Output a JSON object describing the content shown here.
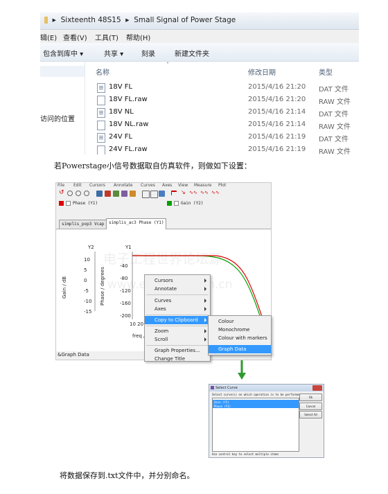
{
  "explorer": {
    "breadcrumb": [
      "Sixteenth 48S15",
      "Small Signal of Power Stage"
    ],
    "menu": [
      "辑(E)",
      "查看(V)",
      "工具(T)",
      "帮助(H)"
    ],
    "toolbar": [
      "包含到库中 ▾",
      "共享 ▾",
      "刻录",
      "新建文件夹"
    ],
    "left_item": "访问的位置",
    "columns": {
      "name": "名称",
      "date": "修改日期",
      "type": "类型"
    },
    "files": [
      {
        "name": "18V FL",
        "date": "2015/4/16 21:20",
        "type": "DAT 文件",
        "icon": "dat"
      },
      {
        "name": "18V FL.raw",
        "date": "2015/4/16 21:20",
        "type": "RAW 文件",
        "icon": "raw"
      },
      {
        "name": "18V NL",
        "date": "2015/4/16 21:14",
        "type": "DAT 文件",
        "icon": "dat"
      },
      {
        "name": "18V NL.raw",
        "date": "2015/4/16 21:14",
        "type": "RAW 文件",
        "icon": "raw"
      },
      {
        "name": "24V FL",
        "date": "2015/4/16 21:19",
        "type": "DAT 文件",
        "icon": "dat"
      },
      {
        "name": "24V FL.raw",
        "date": "2015/4/16 21:19",
        "type": "RAW 文件",
        "icon": "raw"
      }
    ]
  },
  "para1": "若Powerstage小信号数据取自仿真软件，则做如下设置：",
  "simetrix": {
    "menu": [
      "File",
      "Edit",
      "Cursors",
      "Annotate",
      "Curves",
      "Axes",
      "View",
      "Measure",
      "Plot"
    ],
    "legend": {
      "phase": "Phase (Y1)",
      "gain": "Gain (Y2)",
      "phase_color": "#e00000",
      "gain_color": "#00a000"
    },
    "tabs": [
      "simplis_pop3 Vcap",
      "simplis_ac3 Phase (Y1)"
    ],
    "axis": {
      "y2_title": "Y2",
      "y1_title": "Y1",
      "gain_label": "Gain / dB",
      "phase_label": "Phase / degrees",
      "gain_ticks": [
        "10",
        "5",
        "0",
        "-5",
        "-10",
        "-15"
      ],
      "phase_ticks": [
        "-40",
        "-80",
        "-120",
        "-160",
        "-200"
      ],
      "x_ticks_partial": "10  20",
      "x_label_partial": "freq /"
    },
    "watermark_cn": "电子工程世界论坛源",
    "watermark_en": "www.eeworld.com.cn",
    "status": "&Graph Data",
    "context_menu": {
      "items": [
        "Cursors",
        "Annotate",
        "Curves",
        "Axes",
        "Copy to Clipboard",
        "Zoom",
        "Scroll",
        "Graph Properties...",
        "Change Title"
      ],
      "submenu": [
        "Colour",
        "Monochrome",
        "Colour with markers",
        "Graph Data"
      ]
    }
  },
  "dialog": {
    "title": "Select Curve",
    "prompt": "Select curve(s) on which operation is to be performed",
    "items": [
      "Gain (Y2)",
      "Phase (Y1)"
    ],
    "buttons": [
      "Ok",
      "Cancel",
      "Select All"
    ],
    "hint": "Use control key to select multiple items"
  },
  "para2": "将数据保存到.txt文件中，并分别命名。"
}
